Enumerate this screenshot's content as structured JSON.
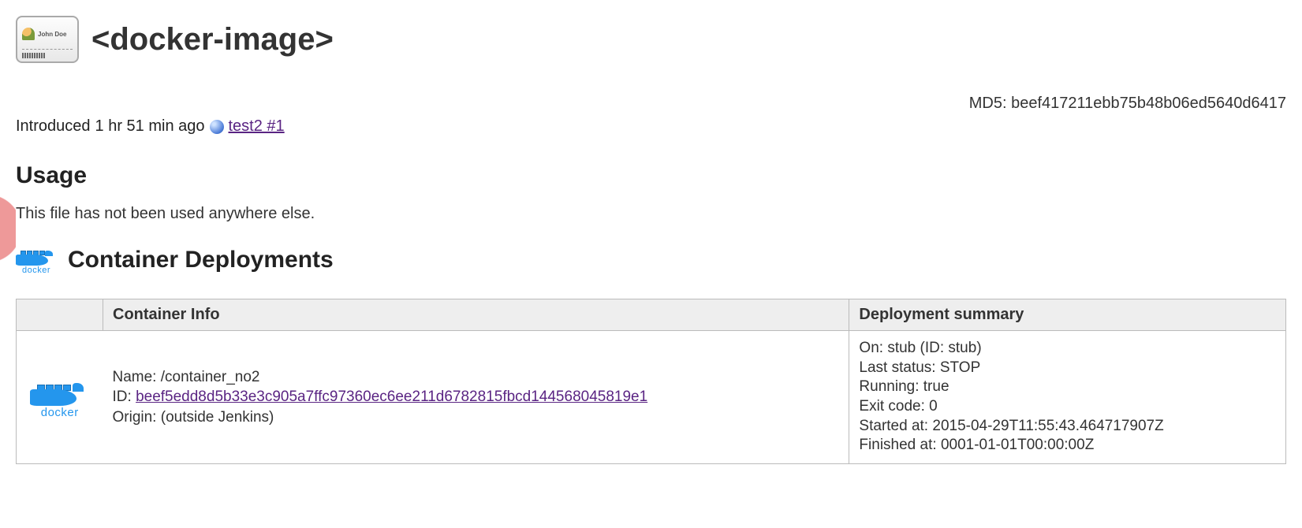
{
  "header": {
    "badge_name": "John Doe",
    "title": "<docker-image>"
  },
  "md5": {
    "label": "MD5:",
    "value": "beef417211ebb75b48b06ed5640d6417"
  },
  "introduced": {
    "prefix": "Introduced",
    "ago": "1 hr 51 min ago",
    "build_link": "test2 #1"
  },
  "usage": {
    "heading": "Usage",
    "text": "This file has not been used anywhere else."
  },
  "deployments": {
    "heading": "Container Deployments",
    "docker_label": "docker",
    "columns": {
      "icon": "",
      "info": "Container Info",
      "summary": "Deployment summary"
    },
    "row": {
      "docker_label": "docker",
      "info": {
        "name_label": "Name:",
        "name_value": "/container_no2",
        "id_label": "ID:",
        "id_value": "beef5edd8d5b33e3c905a7ffc97360ec6ee211d6782815fbcd144568045819e1",
        "origin_label": "Origin:",
        "origin_value": "(outside Jenkins)"
      },
      "summary": {
        "on_label": "On:",
        "on_value": "stub (ID: stub)",
        "status_label": "Last status:",
        "status_value": "STOP",
        "running_label": "Running:",
        "running_value": "true",
        "exit_label": "Exit code:",
        "exit_value": "0",
        "started_label": "Started at:",
        "started_value": "2015-04-29T11:55:43.464717907Z",
        "finished_label": "Finished at:",
        "finished_value": "0001-01-01T00:00:00Z"
      }
    }
  }
}
